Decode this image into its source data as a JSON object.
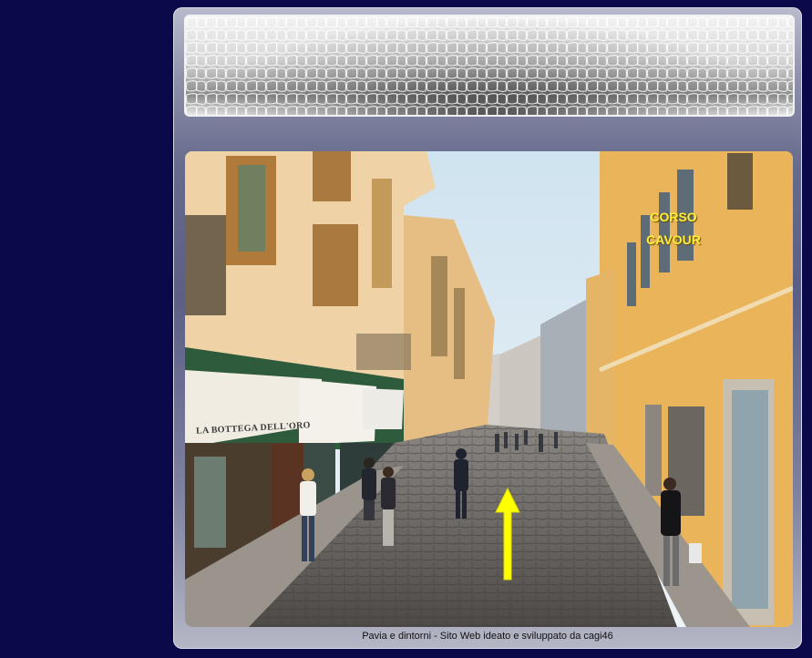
{
  "photo": {
    "street_name_line1": "CORSO",
    "street_name_line2": "CAVOUR",
    "shop_sign": "LA BOTTEGA DELL'ORO",
    "direction_arrow": "up-arrow",
    "arrow_color": "#ffff00"
  },
  "footer": {
    "text": "Pavia e dintorni - Sito Web ideato e sviluppato da cagi46"
  },
  "colors": {
    "page_background": "#0a0a4a",
    "label_yellow": "#ffef3a"
  }
}
